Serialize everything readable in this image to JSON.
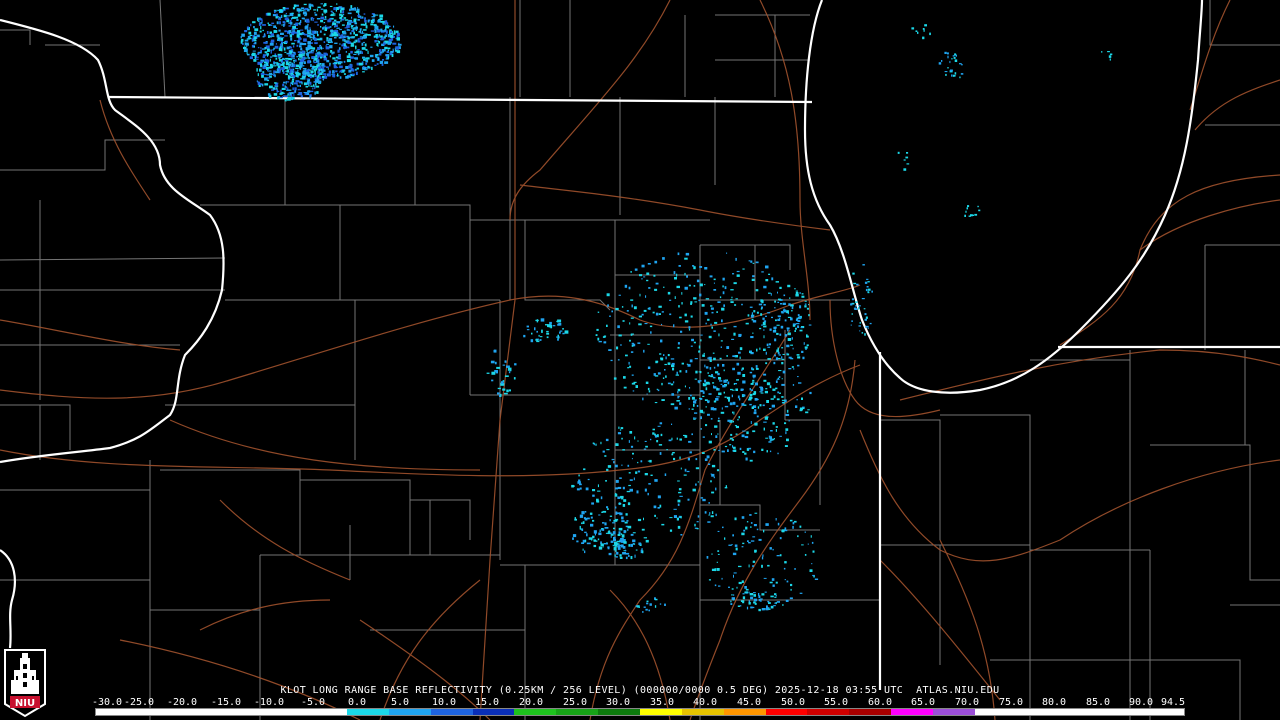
{
  "title": "KLOT LONG RANGE BASE REFLECTIVITY (0.25KM / 256 LEVEL) (000000/0000 0.5 DEG) 2025-12-18 03:55 UTC  ATLAS.NIU.EDU",
  "scale": {
    "labels": [
      "-30.0",
      "-25.0",
      "-20.0",
      "-15.0",
      "-10.0",
      "-5.0",
      "0.0",
      "5.0",
      "10.0",
      "15.0",
      "20.0",
      "25.0",
      "30.0",
      "35.0",
      "40.0",
      "45.0",
      "50.0",
      "55.0",
      "60.0",
      "65.0",
      "70.0",
      "75.0",
      "80.0",
      "85.0",
      "90.0",
      "94.5"
    ],
    "colors": [
      "#ffffff",
      "#ffffff",
      "#ffffff",
      "#ffffff",
      "#ffffff",
      "#ffffff",
      "#1bd8e8",
      "#1fa4f0",
      "#1e64e0",
      "#0a2fb8",
      "#1ec21e",
      "#17a317",
      "#0d7a0d",
      "#ffff00",
      "#e6c300",
      "#ff9600",
      "#ff0000",
      "#d00000",
      "#a80000",
      "#ff00ff",
      "#9c4fd8",
      "#ffffff",
      "#ffffff",
      "#ffffff",
      "#ffffff",
      "#ffffff"
    ]
  },
  "logo": {
    "text": "NIU",
    "icon": "niu-tower-logo-icon",
    "accent": "#c8102e"
  },
  "map": {
    "background": "#000000",
    "state_border_color": "#ffffff",
    "county_line_color": "#8a8a8a",
    "highway_color": "#a0522d",
    "echo_colors": [
      "#1bd8e8",
      "#1fa4f0",
      "#1e64e0"
    ]
  }
}
